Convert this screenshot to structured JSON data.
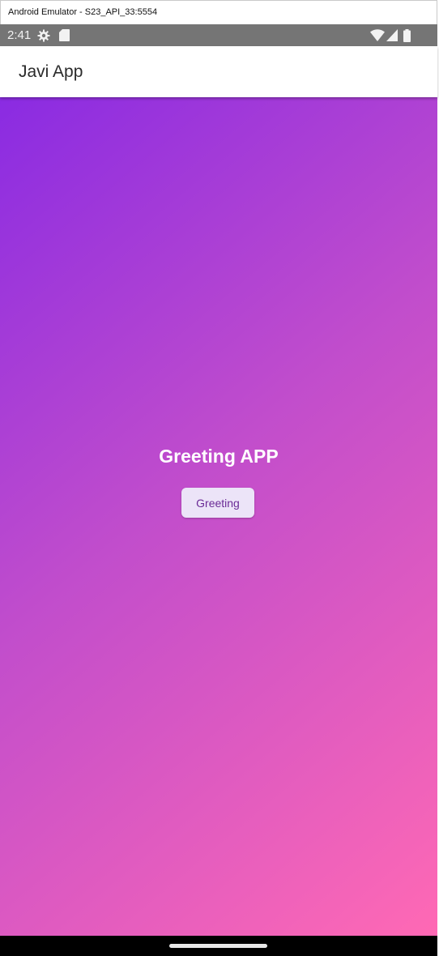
{
  "window": {
    "title": "Android Emulator - S23_API_33:5554"
  },
  "status_bar": {
    "time": "2:41",
    "icons": [
      "settings-gear-icon",
      "sd-card-icon",
      "wifi-icon",
      "cellular-signal-icon",
      "battery-icon"
    ]
  },
  "app_bar": {
    "title": "Javi App"
  },
  "main": {
    "heading": "Greeting APP",
    "button_label": "Greeting"
  },
  "colors": {
    "status_bar": "#757575",
    "gradient_start": "#8a2be2",
    "gradient_end": "#ff69b4",
    "button_bg": "#ece4f8",
    "button_text": "#6a2a96"
  }
}
